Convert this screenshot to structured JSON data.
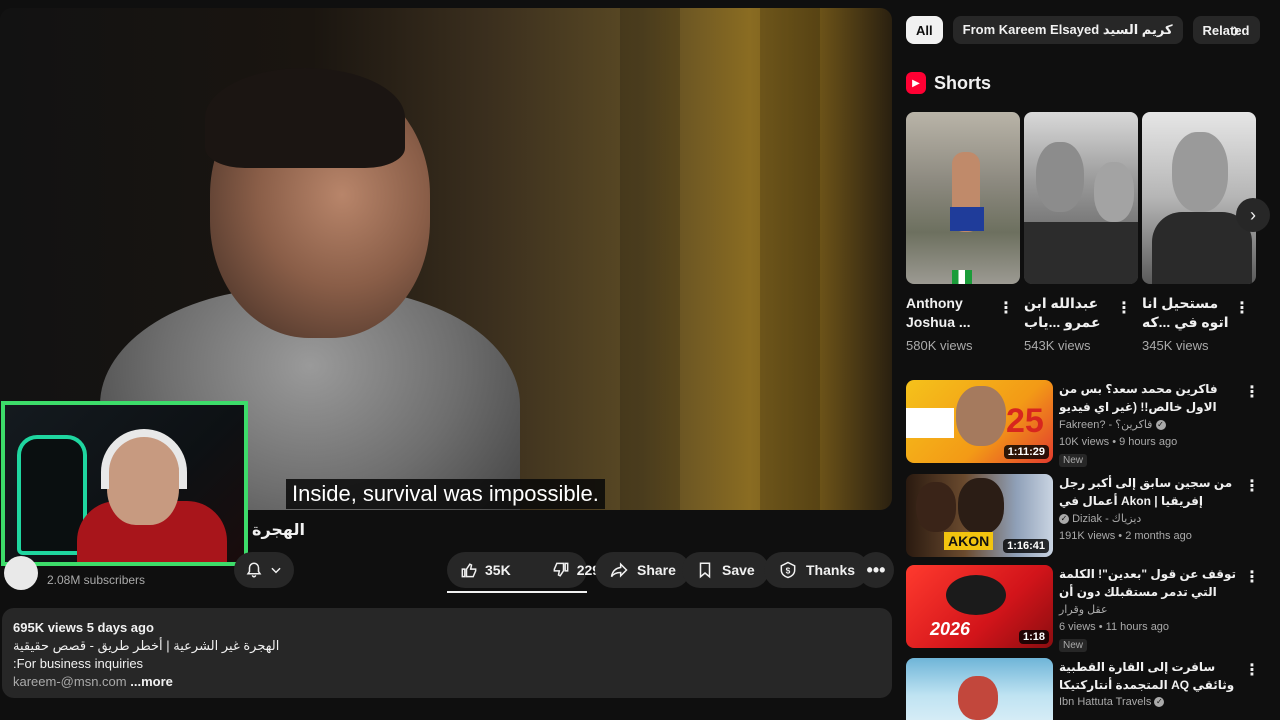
{
  "player": {
    "subtitle": "Inside, survival was impossible.",
    "video_title": "الهجرة"
  },
  "channel": {
    "subscribers": "2.08M subscribers"
  },
  "actions": {
    "likes": "35K",
    "dislikes": "229",
    "share": "Share",
    "save": "Save",
    "thanks": "Thanks"
  },
  "description": {
    "meta": "695K views  5 days ago",
    "line1": "الهجرة غير الشرعية | أخطر طريق - قصص حقيقية",
    "line2": ":For business inquiries",
    "line3": "kareem-@msn.com",
    "more": "...more"
  },
  "chips": [
    "All",
    "From Kareem Elsayed كريم السيد",
    "Related"
  ],
  "shorts": {
    "title": "Shorts",
    "items": [
      {
        "title": "Anthony Joshua ...",
        "views": "580K views"
      },
      {
        "title": "عبدالله ابن عمرو ...ياب هيناقس أبوه",
        "views": "543K views"
      },
      {
        "title": "مستحيل انا اتوه في ...كه فيها ف الاخر",
        "views": "345K views"
      }
    ]
  },
  "videos": [
    {
      "title": "فاكرين محمد سعد؟ بس من الاول خالص!! (غير اي فيديو انت شوفته)",
      "channel": "Fakreen? - فاكرين؟",
      "meta": "10K views • 9 hours ago",
      "duration": "1:11:29",
      "badge": "New"
    },
    {
      "title": "من سجين سابق إلى أكبر رجل أعمال في Akon | إفريقيا",
      "channel": "Diziak - ديزياك",
      "meta": "191K views • 2 months ago",
      "duration": "1:16:41",
      "badge": ""
    },
    {
      "title": "توقف عن قول \"بعدين\"! الكلمة التي تدمر مستقبلك دون أن تشعر ⚠️",
      "channel": "عقل وقرار",
      "meta": "6 views • 11 hours ago",
      "duration": "1:18",
      "badge": "New"
    },
    {
      "title": "سافرت إلى القارة القطبية المتجمدة أنتاركتيكا AQ وثائقي التجربة كاملة",
      "channel": "Ibn Hattuta Travels",
      "meta": "",
      "duration": "",
      "badge": ""
    }
  ],
  "colors": {
    "accent": "#3ddc6a",
    "youtube_red": "#ff0033",
    "surface": "#272727",
    "background": "#0f0f0f"
  }
}
